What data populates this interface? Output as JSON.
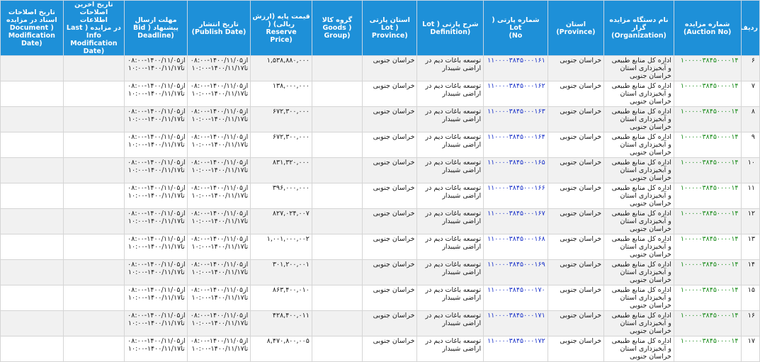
{
  "headers": {
    "radif": "ردیف",
    "auction_no": "شماره مزایده\n(Auction No)",
    "organization": "نام دستگاه مزایده گزار\n(Organization)",
    "province": "استان\n(Province)",
    "lot_no": "شماره پارتی ( Lot\nNo)",
    "definition": "شرح پارتی ( Lot\n(Definition",
    "lot_province": "استان پارتی\n( Lot\n(Province",
    "goods_group": "گروه کالا\n( Goods\n(Group",
    "reserve_price": "قیمت پایه (ارزش\nریالی) ( Reserve\n(Price",
    "publish_date": "تاریخ انتشار\n(Publish Date)",
    "bid_deadline": "مهلت ارسال\nپیشنهاد ( Bid\n(Deadline",
    "last_info_mod": "تاریخ آخرین\nاصلاحات اطلاعات\nدر مزایده ( Last\nInfo\nModification\n(Date",
    "doc_mod": "تاریخ اصلاحات\nاسناد در مزایده\n( Document\nModification\n(Date"
  },
  "rows": [
    {
      "radif": "۶",
      "auction": "۱۰۰۰۰۰۳۸۴۵۰۰۰۰۱۴",
      "org": "اداره کل منابع طبیعی و آبخیزداری استان خراسان جنوبی",
      "province": "خراسان جنوبی",
      "lot": "۱۱۰۰۰۰۳۸۴۵۰۰۰۱۶۱",
      "definition": "توسعه باغات دیم در اراضی شیبدار",
      "lot_province": "خراسان جنوبی",
      "goods": "",
      "price": "۱,۵۳۸,۸۸۰,۰۰۰",
      "publish": "از۱۴۰۰/۱۱/۰۵-۰۸:۰۰\nتا۱۴۰۰/۱۱/۱۷-۱۰:۰۰",
      "deadline": "از۱۴۰۰/۱۱/۰۵-۰۸:۰۰\nتا۱۴۰۰/۱۱/۱۷-۱۰:۰۰",
      "last_info": "",
      "doc_mod": ""
    },
    {
      "radif": "۷",
      "auction": "۱۰۰۰۰۰۳۸۴۵۰۰۰۰۱۴",
      "org": "اداره کل منابع طبیعی و آبخیزداری استان خراسان جنوبی",
      "province": "خراسان جنوبی",
      "lot": "۱۱۰۰۰۰۳۸۴۵۰۰۰۱۶۲",
      "definition": "توسعه باغات دیم در اراضی شیبدار",
      "lot_province": "خراسان جنوبی",
      "goods": "",
      "price": "۱۳۸,۰۰۰,۰۰۰",
      "publish": "از۱۴۰۰/۱۱/۰۵-۰۸:۰۰\nتا۱۴۰۰/۱۱/۱۷-۱۰:۰۰",
      "deadline": "از۱۴۰۰/۱۱/۰۵-۰۸:۰۰\nتا۱۴۰۰/۱۱/۱۷-۱۰:۰۰",
      "last_info": "",
      "doc_mod": ""
    },
    {
      "radif": "۸",
      "auction": "۱۰۰۰۰۰۳۸۴۵۰۰۰۰۱۴",
      "org": "اداره کل منابع طبیعی و آبخیزداری استان خراسان جنوبی",
      "province": "خراسان جنوبی",
      "lot": "۱۱۰۰۰۰۳۸۴۵۰۰۰۱۶۳",
      "definition": "توسعه باغات دیم در اراضی شیبدار",
      "lot_province": "خراسان جنوبی",
      "goods": "",
      "price": "۶۷۲,۳۰۰,۰۰۰",
      "publish": "از۱۴۰۰/۱۱/۰۵-۰۸:۰۰\nتا۱۴۰۰/۱۱/۱۷-۱۰:۰۰",
      "deadline": "از۱۴۰۰/۱۱/۰۵-۰۸:۰۰\nتا۱۴۰۰/۱۱/۱۷-۱۰:۰۰",
      "last_info": "",
      "doc_mod": ""
    },
    {
      "radif": "۹",
      "auction": "۱۰۰۰۰۰۳۸۴۵۰۰۰۰۱۴",
      "org": "اداره کل منابع طبیعی و آبخیزداری استان خراسان جنوبی",
      "province": "خراسان جنوبی",
      "lot": "۱۱۰۰۰۰۳۸۴۵۰۰۰۱۶۴",
      "definition": "توسعه باغات دیم در اراضی شیبدار",
      "lot_province": "خراسان جنوبی",
      "goods": "",
      "price": "۶۷۲,۳۰۰,۰۰۰",
      "publish": "از۱۴۰۰/۱۱/۰۵-۰۸:۰۰\nتا۱۴۰۰/۱۱/۱۷-۱۰:۰۰",
      "deadline": "از۱۴۰۰/۱۱/۰۵-۰۸:۰۰\nتا۱۴۰۰/۱۱/۱۷-۱۰:۰۰",
      "last_info": "",
      "doc_mod": ""
    },
    {
      "radif": "۱۰",
      "auction": "۱۰۰۰۰۰۳۸۴۵۰۰۰۰۱۴",
      "org": "اداره کل منابع طبیعی و آبخیزداری استان خراسان جنوبی",
      "province": "خراسان جنوبی",
      "lot": "۱۱۰۰۰۰۳۸۴۵۰۰۰۱۶۵",
      "definition": "توسعه باغات دیم در اراضی شیبدار",
      "lot_province": "خراسان جنوبی",
      "goods": "",
      "price": "۸۳۱,۳۲۰,۰۰۰",
      "publish": "از۱۴۰۰/۱۱/۰۵-۰۸:۰۰\nتا۱۴۰۰/۱۱/۱۷-۱۰:۰۰",
      "deadline": "از۱۴۰۰/۱۱/۰۵-۰۸:۰۰\nتا۱۴۰۰/۱۱/۱۷-۱۰:۰۰",
      "last_info": "",
      "doc_mod": ""
    },
    {
      "radif": "۱۱",
      "auction": "۱۰۰۰۰۰۳۸۴۵۰۰۰۰۱۴",
      "org": "اداره کل منابع طبیعی و آبخیزداری استان خراسان جنوبی",
      "province": "خراسان جنوبی",
      "lot": "۱۱۰۰۰۰۳۸۴۵۰۰۰۱۶۶",
      "definition": "توسعه باغات دیم در اراضی شیبدار",
      "lot_province": "خراسان جنوبی",
      "goods": "",
      "price": "۳۹۶,۰۰۰,۰۰۰",
      "publish": "از۱۴۰۰/۱۱/۰۵-۰۸:۰۰\nتا۱۴۰۰/۱۱/۱۷-۱۰:۰۰",
      "deadline": "از۱۴۰۰/۱۱/۰۵-۰۸:۰۰\nتا۱۴۰۰/۱۱/۱۷-۱۰:۰۰",
      "last_info": "",
      "doc_mod": ""
    },
    {
      "radif": "۱۲",
      "auction": "۱۰۰۰۰۰۳۸۴۵۰۰۰۰۱۴",
      "org": "اداره کل منابع طبیعی و آبخیزداری استان خراسان جنوبی",
      "province": "خراسان جنوبی",
      "lot": "۱۱۰۰۰۰۳۸۴۵۰۰۰۱۶۷",
      "definition": "توسعه باغات دیم در اراضی شیبدار",
      "lot_province": "خراسان جنوبی",
      "goods": "",
      "price": "۸۲۷,۰۲۴,۰۰۷",
      "publish": "از۱۴۰۰/۱۱/۰۵-۰۸:۰۰\nتا۱۴۰۰/۱۱/۱۷-۱۰:۰۰",
      "deadline": "از۱۴۰۰/۱۱/۰۵-۰۸:۰۰\nتا۱۴۰۰/۱۱/۱۷-۱۰:۰۰",
      "last_info": "",
      "doc_mod": ""
    },
    {
      "radif": "۱۳",
      "auction": "۱۰۰۰۰۰۳۸۴۵۰۰۰۰۱۴",
      "org": "اداره کل منابع طبیعی و آبخیزداری استان خراسان جنوبی",
      "province": "خراسان جنوبی",
      "lot": "۱۱۰۰۰۰۳۸۴۵۰۰۰۱۶۸",
      "definition": "توسعه باغات دیم در اراضی شیبدار",
      "lot_province": "خراسان جنوبی",
      "goods": "",
      "price": "۱,۰۰۱,۰۰۰,۰۰۲",
      "publish": "از۱۴۰۰/۱۱/۰۵-۰۸:۰۰\nتا۱۴۰۰/۱۱/۱۷-۱۰:۰۰",
      "deadline": "از۱۴۰۰/۱۱/۰۵-۰۸:۰۰\nتا۱۴۰۰/۱۱/۱۷-۱۰:۰۰",
      "last_info": "",
      "doc_mod": ""
    },
    {
      "radif": "۱۴",
      "auction": "۱۰۰۰۰۰۳۸۴۵۰۰۰۰۱۴",
      "org": "اداره کل منابع طبیعی و آبخیزداری استان خراسان جنوبی",
      "province": "خراسان جنوبی",
      "lot": "۱۱۰۰۰۰۳۸۴۵۰۰۰۱۶۹",
      "definition": "توسعه باغات دیم در اراضی شیبدار",
      "lot_province": "خراسان جنوبی",
      "goods": "",
      "price": "۳۰۱,۲۰۰,۰۰۱",
      "publish": "از۱۴۰۰/۱۱/۰۵-۰۸:۰۰\nتا۱۴۰۰/۱۱/۱۷-۱۰:۰۰",
      "deadline": "از۱۴۰۰/۱۱/۰۵-۰۸:۰۰\nتا۱۴۰۰/۱۱/۱۷-۱۰:۰۰",
      "last_info": "",
      "doc_mod": ""
    },
    {
      "radif": "۱۵",
      "auction": "۱۰۰۰۰۰۳۸۴۵۰۰۰۰۱۴",
      "org": "اداره کل منابع طبیعی و آبخیزداری استان خراسان جنوبی",
      "province": "خراسان جنوبی",
      "lot": "۱۱۰۰۰۰۳۸۴۵۰۰۰۱۷۰",
      "definition": "توسعه باغات دیم در اراضی شیبدار",
      "lot_province": "خراسان جنوبی",
      "goods": "",
      "price": "۸۶۳,۴۰۰,۰۱۰",
      "publish": "از۱۴۰۰/۱۱/۰۵-۰۸:۰۰\nتا۱۴۰۰/۱۱/۱۷-۱۰:۰۰",
      "deadline": "از۱۴۰۰/۱۱/۰۵-۰۸:۰۰\nتا۱۴۰۰/۱۱/۱۷-۱۰:۰۰",
      "last_info": "",
      "doc_mod": ""
    },
    {
      "radif": "۱۶",
      "auction": "۱۰۰۰۰۰۳۸۴۵۰۰۰۰۱۴",
      "org": "اداره کل منابع طبیعی و آبخیزداری استان خراسان جنوبی",
      "province": "خراسان جنوبی",
      "lot": "۱۱۰۰۰۰۳۸۴۵۰۰۰۱۷۱",
      "definition": "توسعه باغات دیم در اراضی شیبدار",
      "lot_province": "خراسان جنوبی",
      "goods": "",
      "price": "۴۲۸,۴۰۰,۰۱۱",
      "publish": "از۱۴۰۰/۱۱/۰۵-۰۸:۰۰\nتا۱۴۰۰/۱۱/۱۷-۱۰:۰۰",
      "deadline": "از۱۴۰۰/۱۱/۰۵-۰۸:۰۰\nتا۱۴۰۰/۱۱/۱۷-۱۰:۰۰",
      "last_info": "",
      "doc_mod": ""
    },
    {
      "radif": "۱۷",
      "auction": "۱۰۰۰۰۰۳۸۴۵۰۰۰۰۱۴",
      "org": "اداره کل منابع طبیعی و آبخیزداری استان خراسان جنوبی",
      "province": "خراسان جنوبی",
      "lot": "۱۱۰۰۰۰۳۸۴۵۰۰۰۱۷۲",
      "definition": "توسعه باغات دیم در اراضی شیبدار",
      "lot_province": "خراسان جنوبی",
      "goods": "",
      "price": "۸,۴۷۰,۸۰۰,۰۰۵",
      "publish": "از۱۴۰۰/۱۱/۰۵-۰۸:۰۰\nتا۱۴۰۰/۱۱/۱۷-۱۰:۰۰",
      "deadline": "از۱۴۰۰/۱۱/۰۵-۰۸:۰۰\nتا۱۴۰۰/۱۱/۱۷-۱۰:۰۰",
      "last_info": "",
      "doc_mod": ""
    }
  ],
  "colors": {
    "header_bg": "#1e90d8",
    "header_text": "#ffffff",
    "auction_link": "#168a17",
    "lot_link": "#1a32c9",
    "row_alt": "#f1f1f1"
  }
}
